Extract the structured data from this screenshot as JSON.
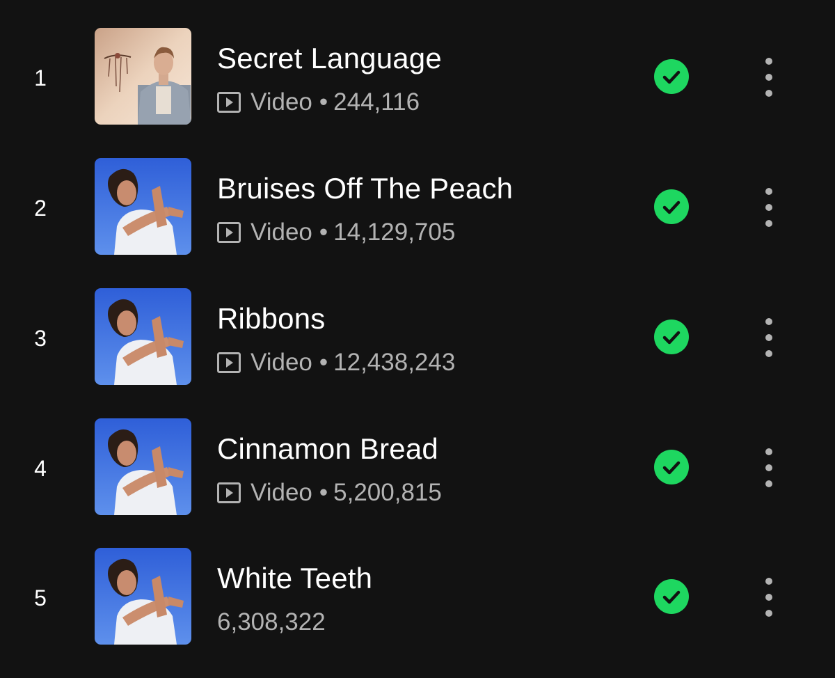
{
  "colors": {
    "background": "#121212",
    "accent_green": "#1ed760",
    "secondary_text": "#b3b3b3"
  },
  "tracks": [
    {
      "number": "1",
      "title": "Secret Language",
      "is_video": true,
      "type_label": "Video",
      "separator": "•",
      "plays": "244,116",
      "downloaded": true,
      "artwork": "secret-language-cover"
    },
    {
      "number": "2",
      "title": "Bruises Off The Peach",
      "is_video": true,
      "type_label": "Video",
      "separator": "•",
      "plays": "14,129,705",
      "downloaded": true,
      "artwork": "blue-sky-cover"
    },
    {
      "number": "3",
      "title": "Ribbons",
      "is_video": true,
      "type_label": "Video",
      "separator": "•",
      "plays": "12,438,243",
      "downloaded": true,
      "artwork": "blue-sky-cover"
    },
    {
      "number": "4",
      "title": "Cinnamon Bread",
      "is_video": true,
      "type_label": "Video",
      "separator": "•",
      "plays": "5,200,815",
      "downloaded": true,
      "artwork": "blue-sky-cover"
    },
    {
      "number": "5",
      "title": "White Teeth",
      "is_video": false,
      "plays": "6,308,322",
      "downloaded": true,
      "artwork": "blue-sky-cover"
    }
  ],
  "icons": {
    "video": "video-play-icon",
    "downloaded": "check-circle-icon",
    "more": "more-vertical-icon"
  }
}
